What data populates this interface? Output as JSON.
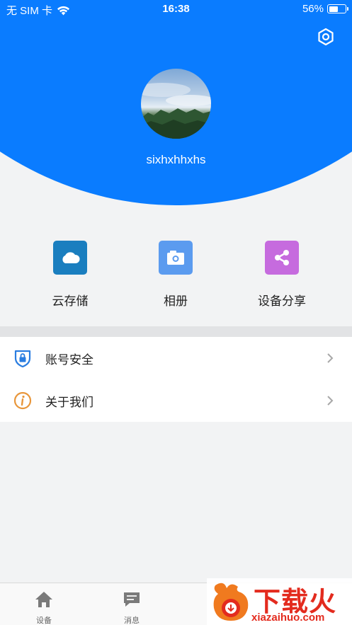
{
  "status_bar": {
    "carrier": "无 SIM 卡",
    "time": "16:38",
    "battery": "56%",
    "battery_level": 0.56
  },
  "profile": {
    "username": "sixhxhhxhs"
  },
  "features": [
    {
      "label": "云存储",
      "icon": "cloud-icon",
      "color": "#1a7ebf"
    },
    {
      "label": "相册",
      "icon": "camera-icon",
      "color": "#5b9bef"
    },
    {
      "label": "设备分享",
      "icon": "share-icon",
      "color": "#c66bde"
    }
  ],
  "menu": [
    {
      "label": "账号安全",
      "icon": "shield-lock-icon",
      "color": "#2a7de0"
    },
    {
      "label": "关于我们",
      "icon": "info-icon",
      "color": "#e8963a"
    }
  ],
  "tabbar": [
    {
      "label": "设备",
      "icon": "home-icon"
    },
    {
      "label": "消息",
      "icon": "message-icon"
    }
  ],
  "watermark": {
    "title": "下载火",
    "subtitle": "xiazaihuo.com"
  },
  "colors": {
    "header": "#0a7cff",
    "background": "#f2f3f4"
  }
}
